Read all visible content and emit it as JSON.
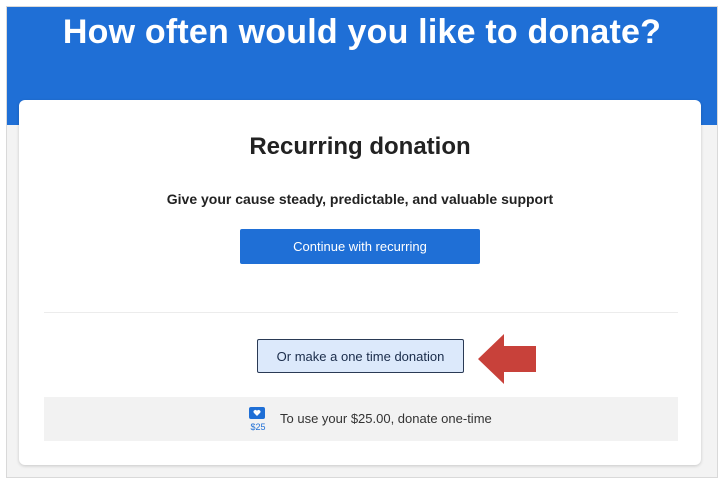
{
  "header": {
    "title": "How often would you like to donate?"
  },
  "card": {
    "title": "Recurring donation",
    "subtitle": "Give your cause steady, predictable, and valuable support",
    "primary_button_label": "Continue with recurring",
    "secondary_button_label": "Or make a one time donation"
  },
  "info": {
    "wallet_amount": "$25",
    "text": "To use your $25.00, donate one-time",
    "icon": "wallet-heart-icon"
  },
  "annotation": {
    "icon": "left-arrow-icon",
    "color": "#c8413a"
  },
  "colors": {
    "brand_blue": "#1f6fd6",
    "secondary_bg": "#dce9fb",
    "secondary_border": "#2a3a55"
  }
}
